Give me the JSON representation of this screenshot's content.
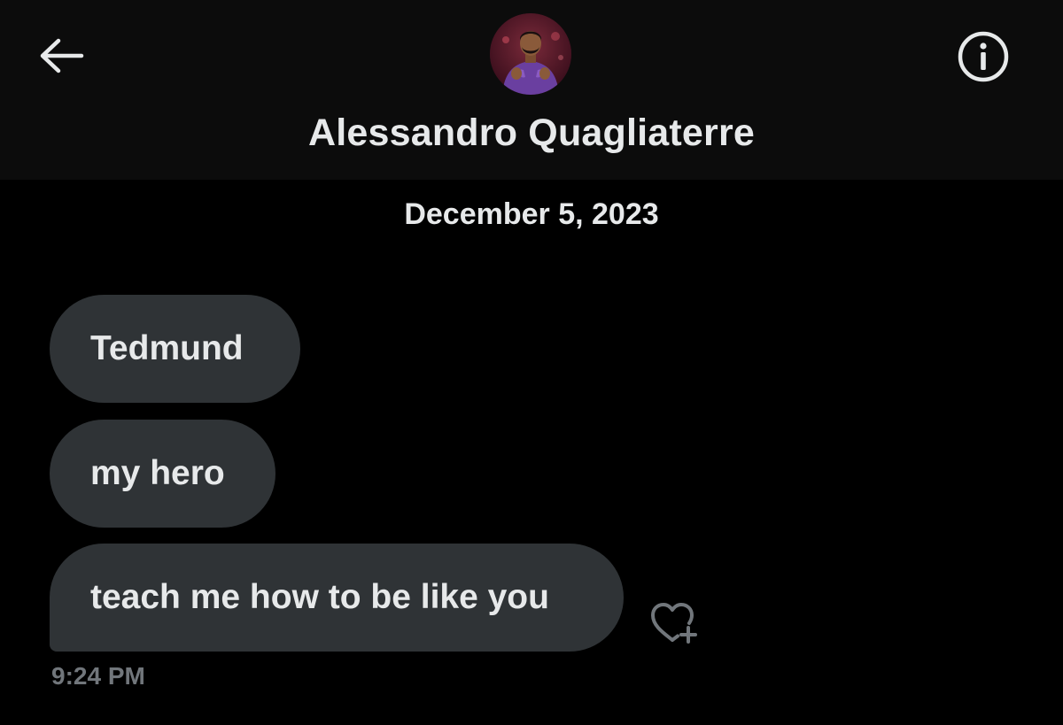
{
  "header": {
    "contact_name": "Alessandro Quagliaterre",
    "back_icon": "arrow-left-icon",
    "info_icon": "info-icon",
    "avatar": "contact-avatar-photo"
  },
  "conversation": {
    "date_separator": "December 5, 2023",
    "messages": [
      {
        "text": "Tedmund"
      },
      {
        "text": "my hero"
      },
      {
        "text": "teach me how to be like you"
      }
    ],
    "last_timestamp": "9:24 PM",
    "reaction_icon": "heart-plus-icon"
  },
  "colors": {
    "background": "#000000",
    "header_background": "#0c0c0c",
    "bubble": "#2f3336",
    "text": "#e7e9ea",
    "muted_text": "#71767b"
  }
}
